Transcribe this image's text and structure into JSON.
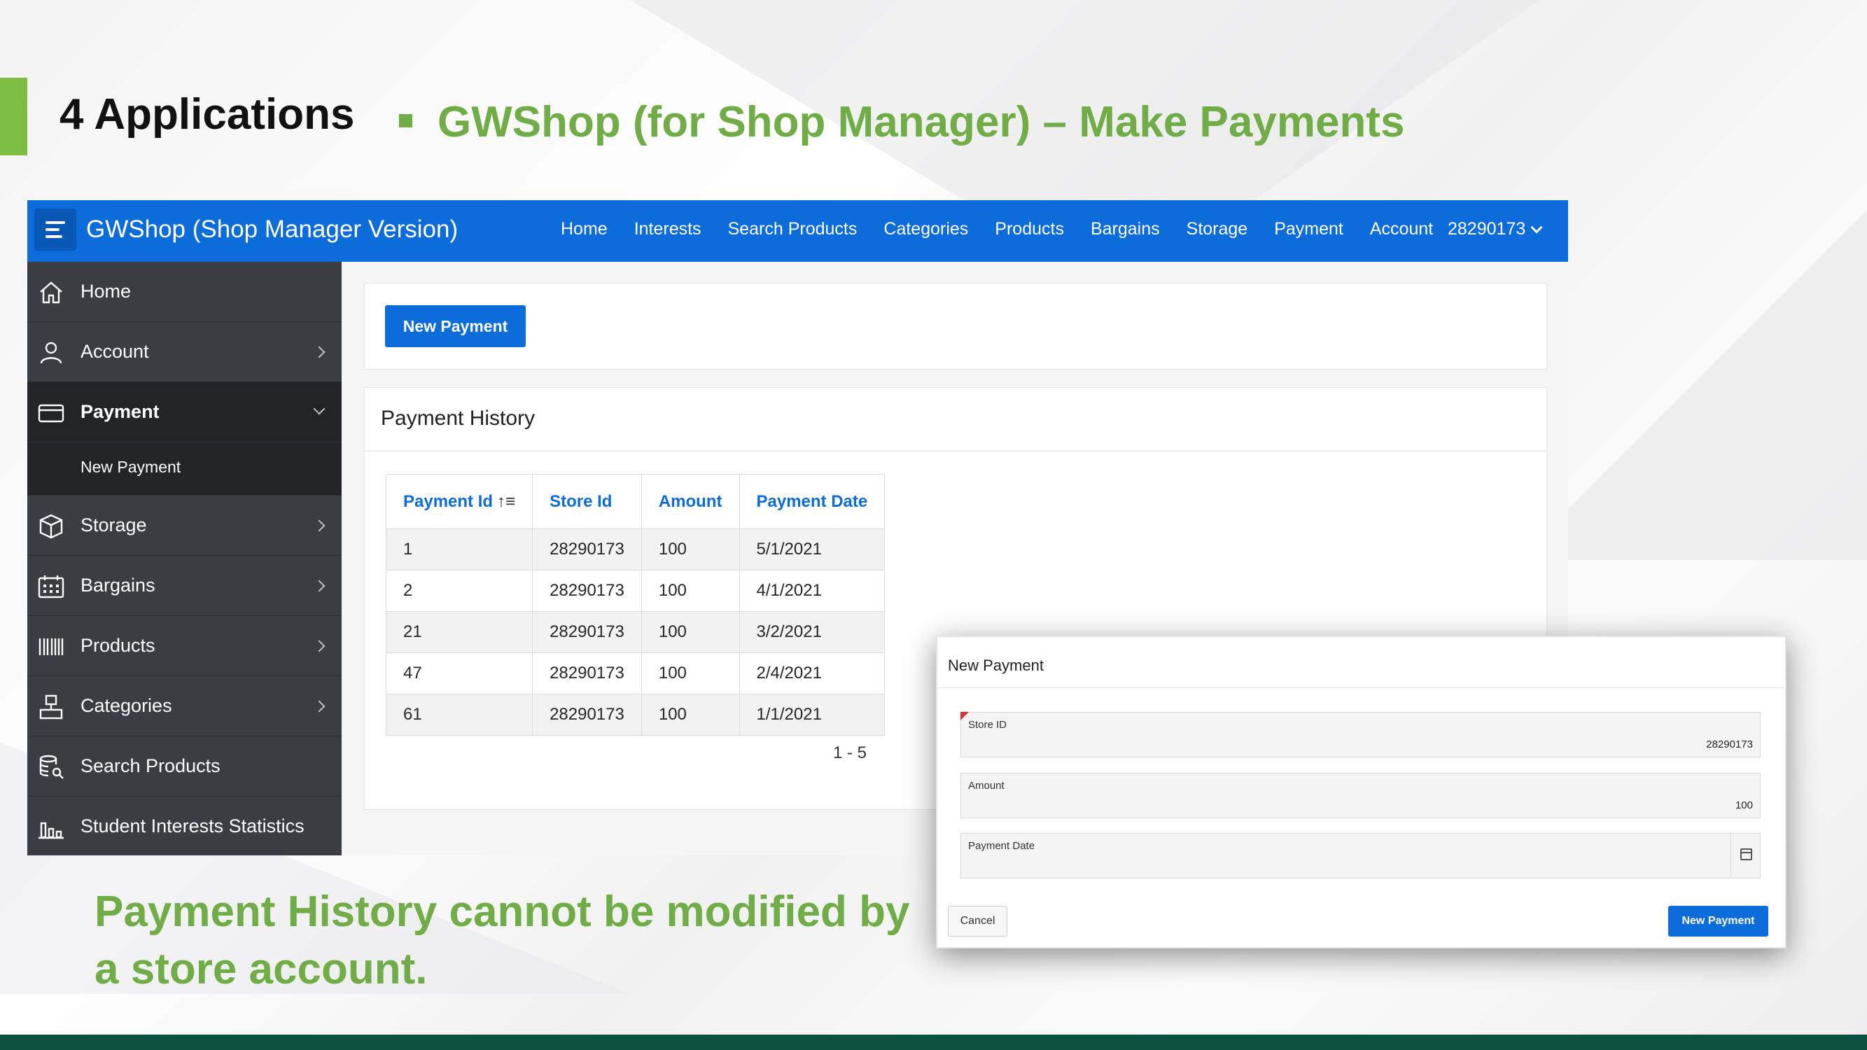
{
  "slide": {
    "title": "4 Applications",
    "subtitle": "GWShop (for Shop Manager) – Make Payments",
    "caption": "Payment History cannot be modified by a store account."
  },
  "app": {
    "title": "GWShop (Shop Manager Version)",
    "top_nav": [
      "Home",
      "Interests",
      "Search Products",
      "Categories",
      "Products",
      "Bargains",
      "Storage",
      "Payment",
      "Account"
    ],
    "user": "28290173"
  },
  "sidebar": {
    "items": [
      {
        "label": "Home",
        "icon": "home-icon"
      },
      {
        "label": "Account",
        "icon": "user-icon"
      },
      {
        "label": "Payment",
        "icon": "credit-card-icon"
      },
      {
        "label": "Storage",
        "icon": "box-icon"
      },
      {
        "label": "Bargains",
        "icon": "calendar-icon"
      },
      {
        "label": "Products",
        "icon": "barcode-icon"
      },
      {
        "label": "Categories",
        "icon": "hierarchy-icon"
      },
      {
        "label": "Search Products",
        "icon": "database-search-icon"
      },
      {
        "label": "Student Interests Statistics",
        "icon": "bar-chart-icon"
      }
    ],
    "sub_item": "New Payment"
  },
  "main": {
    "new_payment_button": "New Payment",
    "history_title": "Payment History",
    "table": {
      "headers": [
        "Payment Id",
        "Store Id",
        "Amount",
        "Payment Date"
      ],
      "rows": [
        [
          "1",
          "28290173",
          "100",
          "5/1/2021"
        ],
        [
          "2",
          "28290173",
          "100",
          "4/1/2021"
        ],
        [
          "21",
          "28290173",
          "100",
          "3/2/2021"
        ],
        [
          "47",
          "28290173",
          "100",
          "2/4/2021"
        ],
        [
          "61",
          "28290173",
          "100",
          "1/1/2021"
        ]
      ]
    },
    "pagination": "1 - 5"
  },
  "modal": {
    "title": "New Payment",
    "fields": [
      {
        "label": "Store ID",
        "value": "28290173"
      },
      {
        "label": "Amount",
        "value": "100"
      },
      {
        "label": "Payment Date",
        "value": ""
      }
    ],
    "cancel_label": "Cancel",
    "submit_label": "New Payment"
  },
  "colors": {
    "accent_green": "#70ad47",
    "topbar_blue": "#0c6cda",
    "sidebar_bg": "#3a3e44",
    "footer": "#0d5140"
  }
}
